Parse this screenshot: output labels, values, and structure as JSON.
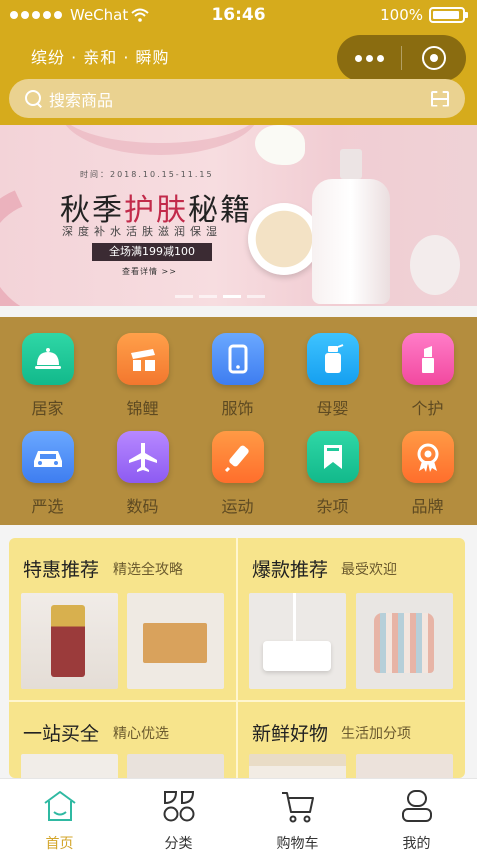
{
  "status_bar": {
    "carrier": "WeChat",
    "time": "16:46",
    "battery": "100%"
  },
  "header": {
    "title": "缤纷 · 亲和 · 瞬购"
  },
  "search": {
    "placeholder": "搜索商品"
  },
  "banner": {
    "date": "时间：2018.10.15-11.15",
    "title_part1": "秋季",
    "title_part2": "护肤",
    "title_part3": "秘籍",
    "subtitle": "深度补水活肤滋润保湿",
    "promo": "全场满199减100",
    "link": "查看详情 >>"
  },
  "categories": [
    {
      "label": "居家",
      "icon": "cloche-icon",
      "color": "#1fc99a"
    },
    {
      "label": "锦鲤",
      "icon": "gift-box-icon",
      "color": "#f88a3a"
    },
    {
      "label": "服饰",
      "icon": "phone-icon",
      "color": "#4f8ff6"
    },
    {
      "label": "母婴",
      "icon": "bottle-icon",
      "color": "#27b3fa"
    },
    {
      "label": "个护",
      "icon": "lipstick-icon",
      "color": "#f862b4"
    },
    {
      "label": "严选",
      "icon": "car-icon",
      "color": "#4f8ff6"
    },
    {
      "label": "数码",
      "icon": "airplane-icon",
      "color": "#a372fa"
    },
    {
      "label": "运动",
      "icon": "syringe-icon",
      "color": "#fb8438"
    },
    {
      "label": "杂项",
      "icon": "bookmark-icon",
      "color": "#1fc99a"
    },
    {
      "label": "品牌",
      "icon": "award-icon",
      "color": "#fb8438"
    }
  ],
  "promos": [
    {
      "title": "特惠推荐",
      "subtitle": "精选全攻略"
    },
    {
      "title": "爆款推荐",
      "subtitle": "最受欢迎"
    },
    {
      "title": "一站买全",
      "subtitle": "精心优选"
    },
    {
      "title": "新鲜好物",
      "subtitle": "生活加分项"
    }
  ],
  "tabbar": [
    {
      "label": "首页",
      "icon": "home-icon",
      "active": true
    },
    {
      "label": "分类",
      "icon": "category-icon",
      "active": false
    },
    {
      "label": "购物车",
      "icon": "cart-icon",
      "active": false
    },
    {
      "label": "我的",
      "icon": "user-icon",
      "active": false
    }
  ],
  "colors": {
    "accent": "#d6ab1c",
    "grid_bg": "#b48d3e",
    "cards_bg": "#f7e48c",
    "tab_active": "#d3a52a"
  }
}
